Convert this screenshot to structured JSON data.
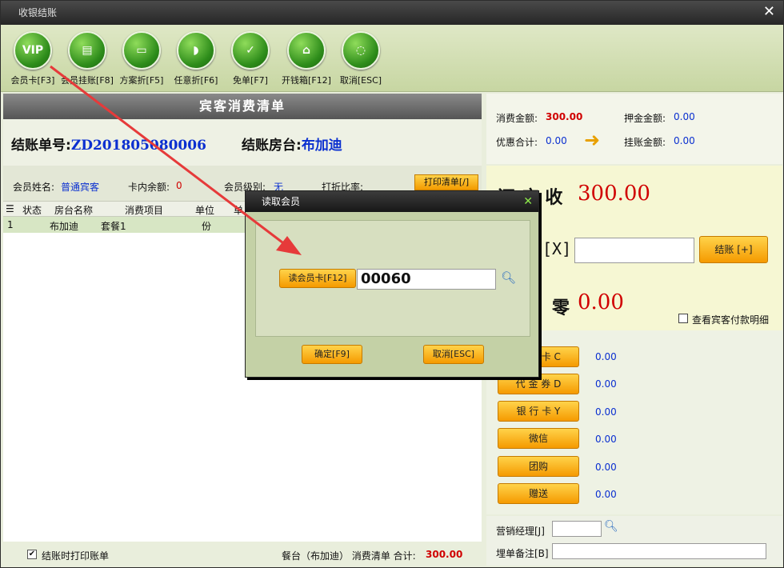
{
  "window": {
    "title": "收银结账",
    "close_glyph": "✕"
  },
  "toolbar": [
    {
      "label": "会员卡[F3]",
      "icon": "vip-card-icon",
      "glyph": "VIP"
    },
    {
      "label": "会员挂账[F8]",
      "icon": "credit-document-icon",
      "glyph": "▤"
    },
    {
      "label": "方案折[F5]",
      "icon": "discount-plan-icon",
      "glyph": "▭"
    },
    {
      "label": "任意折[F6]",
      "icon": "custom-discount-icon",
      "glyph": "◗"
    },
    {
      "label": "免单[F7]",
      "icon": "free-order-icon",
      "glyph": "✓"
    },
    {
      "label": "开钱箱[F12]",
      "icon": "cash-drawer-icon",
      "glyph": "⌂"
    },
    {
      "label": "取消[ESC]",
      "icon": "cancel-icon",
      "glyph": "◌"
    }
  ],
  "left": {
    "panel_title": "宾客消费清单",
    "bill_no_label": "结账单号:",
    "bill_no": "ZD201805080006",
    "table_label": "结账房台:",
    "table_name": "布加迪",
    "member_name_label": "会员姓名:",
    "member_name": "普通宾客",
    "card_balance_label": "卡内余额:",
    "card_balance": "0",
    "member_level_label": "会员级别:",
    "member_level": "无",
    "discount_label": "打折比率:",
    "print_list_btn": "打印清单[/]",
    "columns": [
      "状态",
      "房台名称",
      "消费项目",
      "单位",
      "单"
    ],
    "rows": [
      {
        "no": "1",
        "status": "",
        "room": "布加迪",
        "item": "套餐1",
        "unit": "份"
      }
    ],
    "print_on_checkout": "结账时打印账单",
    "footer_summary": "餐台（布加迪） 消费清单 合计:",
    "footer_total": "300.00"
  },
  "right": {
    "consume_label": "消费金额:",
    "consume_value": "300.00",
    "deposit_label": "押金金额:",
    "deposit_value": "0.00",
    "discount_total_label": "优惠合计:",
    "discount_total_value": "0.00",
    "credit_label": "挂账金额:",
    "credit_value": "0.00",
    "receivable_label": "还 应 收",
    "receivable_value": "300.00",
    "cash_label": "[X]",
    "checkout_btn": "结账 [+]",
    "change_label": "零",
    "change_value": "0.00",
    "view_detail": "查看宾客付款明细",
    "payments": [
      {
        "label": "储 值 卡 C",
        "value": "0.00"
      },
      {
        "label": "代 金 券 D",
        "value": "0.00"
      },
      {
        "label": "银 行 卡 Y",
        "value": "0.00"
      },
      {
        "label": "微信",
        "value": "0.00"
      },
      {
        "label": "团购",
        "value": "0.00"
      },
      {
        "label": "赠送",
        "value": "0.00"
      }
    ],
    "manager_label": "营销经理[J]",
    "remark_label": "埋单备注[B]"
  },
  "dialog": {
    "title": "读取会员",
    "close_glyph": "✕",
    "read_card_btn": "读会员卡[F12]",
    "card_input": "00060",
    "confirm_btn": "确定[F9]",
    "cancel_btn": "取消[ESC]"
  },
  "colors": {
    "accent_red": "#d00000",
    "link_blue": "#0a2fd0",
    "button_orange": "#f5a000",
    "toolbar_green": "#2d8c1a"
  }
}
